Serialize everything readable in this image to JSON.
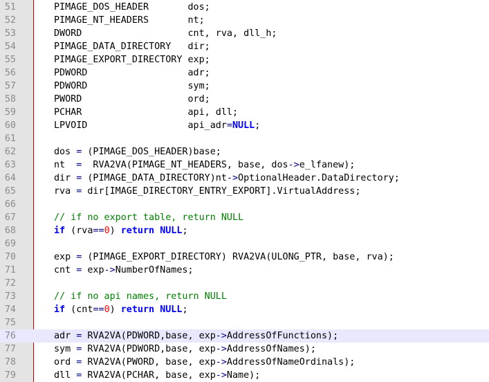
{
  "editor": {
    "lines": [
      {
        "n": "51",
        "tokens": [
          {
            "t": "PIMAGE_DOS_HEADER       dos;",
            "c": "plain"
          }
        ]
      },
      {
        "n": "52",
        "tokens": [
          {
            "t": "PIMAGE_NT_HEADERS       nt;",
            "c": "plain"
          }
        ]
      },
      {
        "n": "53",
        "tokens": [
          {
            "t": "DWORD                   cnt, rva, dll_h;",
            "c": "plain"
          }
        ]
      },
      {
        "n": "54",
        "tokens": [
          {
            "t": "PIMAGE_DATA_DIRECTORY   dir;",
            "c": "plain"
          }
        ]
      },
      {
        "n": "55",
        "tokens": [
          {
            "t": "PIMAGE_EXPORT_DIRECTORY exp;",
            "c": "plain"
          }
        ]
      },
      {
        "n": "56",
        "tokens": [
          {
            "t": "PDWORD                  adr;",
            "c": "plain"
          }
        ]
      },
      {
        "n": "57",
        "tokens": [
          {
            "t": "PDWORD                  sym;",
            "c": "plain"
          }
        ]
      },
      {
        "n": "58",
        "tokens": [
          {
            "t": "PWORD                   ord;",
            "c": "plain"
          }
        ]
      },
      {
        "n": "59",
        "tokens": [
          {
            "t": "PCHAR                   api, dll;",
            "c": "plain"
          }
        ]
      },
      {
        "n": "60",
        "tokens": [
          {
            "t": "LPVOID                  api_adr",
            "c": "plain"
          },
          {
            "t": "=",
            "c": "op"
          },
          {
            "t": "NULL",
            "c": "null"
          },
          {
            "t": ";",
            "c": "plain"
          }
        ]
      },
      {
        "n": "61",
        "tokens": []
      },
      {
        "n": "62",
        "tokens": [
          {
            "t": "dos ",
            "c": "plain"
          },
          {
            "t": "=",
            "c": "op"
          },
          {
            "t": " (PIMAGE_DOS_HEADER)base;",
            "c": "plain"
          }
        ]
      },
      {
        "n": "63",
        "tokens": [
          {
            "t": "nt  ",
            "c": "plain"
          },
          {
            "t": "=",
            "c": "op"
          },
          {
            "t": "  RVA2VA(PIMAGE_NT_HEADERS, base, dos",
            "c": "plain"
          },
          {
            "t": "->",
            "c": "op"
          },
          {
            "t": "e_lfanew);",
            "c": "plain"
          }
        ]
      },
      {
        "n": "64",
        "tokens": [
          {
            "t": "dir ",
            "c": "plain"
          },
          {
            "t": "=",
            "c": "op"
          },
          {
            "t": " (PIMAGE_DATA_DIRECTORY)nt",
            "c": "plain"
          },
          {
            "t": "->",
            "c": "op"
          },
          {
            "t": "OptionalHeader.DataDirectory;",
            "c": "plain"
          }
        ]
      },
      {
        "n": "65",
        "tokens": [
          {
            "t": "rva ",
            "c": "plain"
          },
          {
            "t": "=",
            "c": "op"
          },
          {
            "t": " dir[IMAGE_DIRECTORY_ENTRY_EXPORT].VirtualAddress;",
            "c": "plain"
          }
        ]
      },
      {
        "n": "66",
        "tokens": []
      },
      {
        "n": "67",
        "tokens": [
          {
            "t": "// if no export table, return NULL",
            "c": "cmt"
          }
        ]
      },
      {
        "n": "68",
        "tokens": [
          {
            "t": "if",
            "c": "kw"
          },
          {
            "t": " (rva",
            "c": "plain"
          },
          {
            "t": "==",
            "c": "op"
          },
          {
            "t": "0",
            "c": "num"
          },
          {
            "t": ") ",
            "c": "plain"
          },
          {
            "t": "return",
            "c": "kw"
          },
          {
            "t": " ",
            "c": "plain"
          },
          {
            "t": "NULL",
            "c": "null"
          },
          {
            "t": ";",
            "c": "plain"
          }
        ]
      },
      {
        "n": "69",
        "tokens": []
      },
      {
        "n": "70",
        "tokens": [
          {
            "t": "exp ",
            "c": "plain"
          },
          {
            "t": "=",
            "c": "op"
          },
          {
            "t": " (PIMAGE_EXPORT_DIRECTORY) RVA2VA(ULONG_PTR, base, rva);",
            "c": "plain"
          }
        ]
      },
      {
        "n": "71",
        "tokens": [
          {
            "t": "cnt ",
            "c": "plain"
          },
          {
            "t": "=",
            "c": "op"
          },
          {
            "t": " exp",
            "c": "plain"
          },
          {
            "t": "->",
            "c": "op"
          },
          {
            "t": "NumberOfNames;",
            "c": "plain"
          }
        ]
      },
      {
        "n": "72",
        "tokens": []
      },
      {
        "n": "73",
        "tokens": [
          {
            "t": "// if no api names, return NULL",
            "c": "cmt"
          }
        ]
      },
      {
        "n": "74",
        "tokens": [
          {
            "t": "if",
            "c": "kw"
          },
          {
            "t": " (cnt",
            "c": "plain"
          },
          {
            "t": "==",
            "c": "op"
          },
          {
            "t": "0",
            "c": "num"
          },
          {
            "t": ") ",
            "c": "plain"
          },
          {
            "t": "return",
            "c": "kw"
          },
          {
            "t": " ",
            "c": "plain"
          },
          {
            "t": "NULL",
            "c": "null"
          },
          {
            "t": ";",
            "c": "plain"
          }
        ]
      },
      {
        "n": "75",
        "tokens": []
      },
      {
        "n": "76",
        "highlight": true,
        "tokens": [
          {
            "t": "adr ",
            "c": "plain"
          },
          {
            "t": "=",
            "c": "op"
          },
          {
            "t": " RVA2VA(PDWORD,base, exp",
            "c": "plain"
          },
          {
            "t": "->",
            "c": "op"
          },
          {
            "t": "AddressOfFunctions);",
            "c": "plain"
          }
        ]
      },
      {
        "n": "77",
        "tokens": [
          {
            "t": "sym ",
            "c": "plain"
          },
          {
            "t": "=",
            "c": "op"
          },
          {
            "t": " RVA2VA(PDWORD,base, exp",
            "c": "plain"
          },
          {
            "t": "->",
            "c": "op"
          },
          {
            "t": "AddressOfNames);",
            "c": "plain"
          }
        ]
      },
      {
        "n": "78",
        "tokens": [
          {
            "t": "ord ",
            "c": "plain"
          },
          {
            "t": "=",
            "c": "op"
          },
          {
            "t": " RVA2VA(PWORD, base, exp",
            "c": "plain"
          },
          {
            "t": "->",
            "c": "op"
          },
          {
            "t": "AddressOfNameOrdinals);",
            "c": "plain"
          }
        ]
      },
      {
        "n": "79",
        "tokens": [
          {
            "t": "dll ",
            "c": "plain"
          },
          {
            "t": "=",
            "c": "op"
          },
          {
            "t": " RVA2VA(PCHAR, base, exp",
            "c": "plain"
          },
          {
            "t": "->",
            "c": "op"
          },
          {
            "t": "Name);",
            "c": "plain"
          }
        ]
      }
    ]
  },
  "colors": {
    "gutter": "#e4e4e4",
    "gutter_border": "#cc0000",
    "line_number": "#8a8a8a",
    "keyword": "#0000ff",
    "number": "#ff0000",
    "comment": "#008000",
    "operator": "#000080",
    "current_line": "#e8e8ff"
  }
}
